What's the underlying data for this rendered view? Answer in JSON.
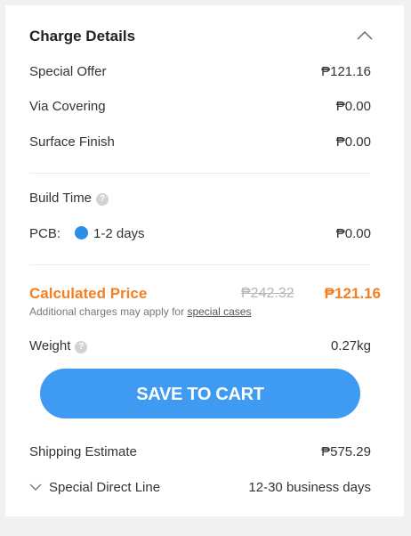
{
  "charge_details": {
    "title": "Charge Details",
    "items": [
      {
        "label": "Special Offer",
        "value": "₱121.16"
      },
      {
        "label": "Via Covering",
        "value": "₱0.00"
      },
      {
        "label": "Surface Finish",
        "value": "₱0.00"
      }
    ]
  },
  "build_time": {
    "label": "Build Time",
    "help_icon": "question-icon",
    "pcb_label": "PCB:",
    "option": "1-2 days",
    "value": "₱0.00"
  },
  "price": {
    "title": "Calculated Price",
    "old_price": "₱242.32",
    "new_price": "₱121.16",
    "note": "Additional charges may apply for ",
    "note_link": "special cases"
  },
  "weight": {
    "label": "Weight",
    "value": "0.27kg"
  },
  "cart_button": {
    "label": "SAVE TO CART"
  },
  "shipping": {
    "label": "Shipping Estimate",
    "value": "₱575.29",
    "method": "Special Direct Line",
    "method_time": "12-30 business days"
  },
  "colors": {
    "accent_orange": "#f57f21",
    "button_blue": "#3f9bf2",
    "radio_blue": "#2c8ee8"
  }
}
